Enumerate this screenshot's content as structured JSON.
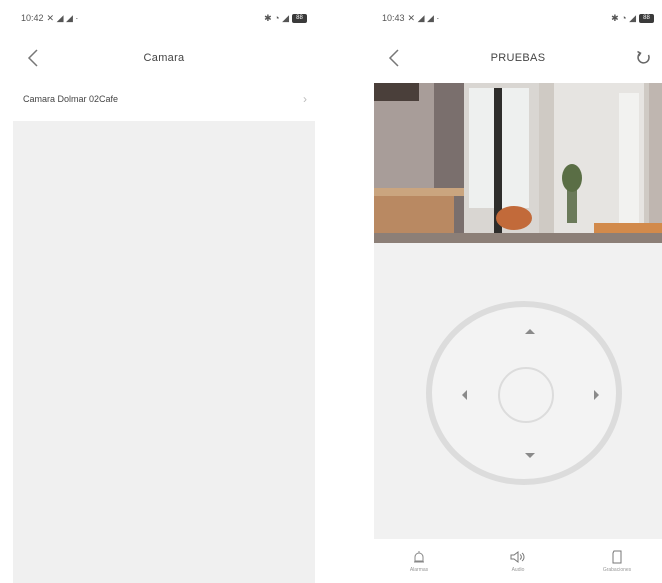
{
  "left_screen": {
    "status": {
      "time": "10:42",
      "indicators_left": "✕ ◢ ◢ ·",
      "indicators_right": "✱ ◔ ◢",
      "battery": "88"
    },
    "nav": {
      "title": "Camara"
    },
    "device_list": [
      {
        "name": "Camara Dolmar 02Cafe"
      }
    ]
  },
  "right_screen": {
    "status": {
      "time": "10:43",
      "indicators_left": "✕ ◢ ◢ ·",
      "indicators_right": "✱ ◔ ◢",
      "battery": "88"
    },
    "nav": {
      "title": "PRUEBAS"
    },
    "bottom_tabs": [
      {
        "icon": "alarm-icon",
        "label": "Alarmas"
      },
      {
        "icon": "speaker-icon",
        "label": "Audio"
      },
      {
        "icon": "sd-card-icon",
        "label": "Grabaciones"
      }
    ]
  },
  "colors": {
    "background": "#ffffff",
    "panel": "#f0f0f0",
    "ring": "#dcdcdc",
    "arrow": "#8a8a8a"
  }
}
